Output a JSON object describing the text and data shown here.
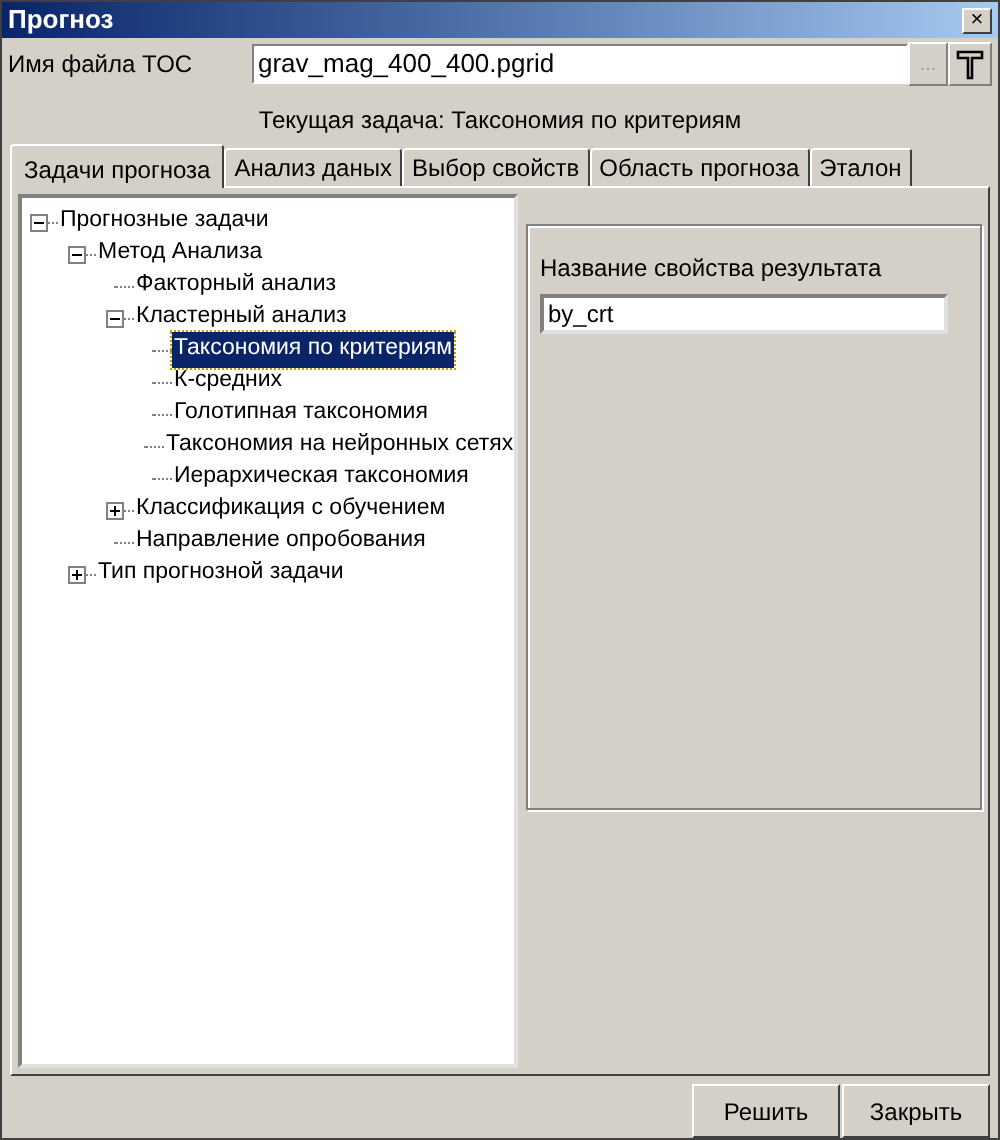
{
  "window": {
    "title": "Прогноз",
    "close": "×"
  },
  "toc_file": {
    "label": "Имя файла TOC",
    "value": "grav_mag_400_400.pgrid",
    "browse": "..."
  },
  "current_task": "Текущая задача: Таксономия по критериям",
  "tabs": [
    {
      "label": "Задачи прогноза",
      "selected": true
    },
    {
      "label": "Анализ даных",
      "selected": false
    },
    {
      "label": "Выбор свойств",
      "selected": false
    },
    {
      "label": "Область прогноза",
      "selected": false
    },
    {
      "label": "Эталон",
      "selected": false
    }
  ],
  "tree": [
    {
      "label": "Прогнозные задачи",
      "expanded": true,
      "selected": false,
      "children": [
        {
          "label": "Метод Анализа",
          "expanded": true,
          "selected": false,
          "children": [
            {
              "label": "Факторный анализ",
              "selected": false
            },
            {
              "label": "Кластерный анализ",
              "expanded": true,
              "selected": false,
              "children": [
                {
                  "label": "Таксономия по критериям",
                  "selected": true
                },
                {
                  "label": "К-средних",
                  "selected": false
                },
                {
                  "label": "Голотипная таксономия",
                  "selected": false
                },
                {
                  "label": "Таксономия на нейронных сетях",
                  "selected": false
                },
                {
                  "label": "Иерархическая таксономия",
                  "selected": false
                }
              ]
            },
            {
              "label": "Классификация с обучением",
              "expanded": false,
              "selected": false
            },
            {
              "label": "Направление опробования",
              "selected": false
            }
          ]
        },
        {
          "label": "Тип прогнозной задачи",
          "expanded": false,
          "selected": false
        }
      ]
    }
  ],
  "result_property": {
    "label": "Название свойства результата",
    "value": "by_crt"
  },
  "buttons": [
    "Решить",
    "Закрыть"
  ]
}
